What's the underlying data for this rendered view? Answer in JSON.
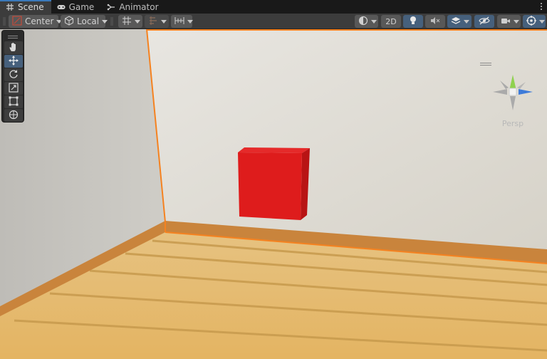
{
  "tabs": [
    {
      "label": "Scene",
      "icon": "grid-icon",
      "active": true
    },
    {
      "label": "Game",
      "icon": "gamepad-icon",
      "active": false
    },
    {
      "label": "Animator",
      "icon": "animator-icon",
      "active": false
    }
  ],
  "toolbar": {
    "pivot_mode": "Center",
    "pivot_rotation": "Local",
    "mode_2d": "2D"
  },
  "gizmo": {
    "projection_label": "Persp"
  },
  "colors": {
    "accent": "#3a79bb",
    "selection_outline": "#f58220",
    "cube": "#de1c1c",
    "wall": "#d9d7d1",
    "floor": "#e2b56b",
    "trim": "#c9843c"
  }
}
